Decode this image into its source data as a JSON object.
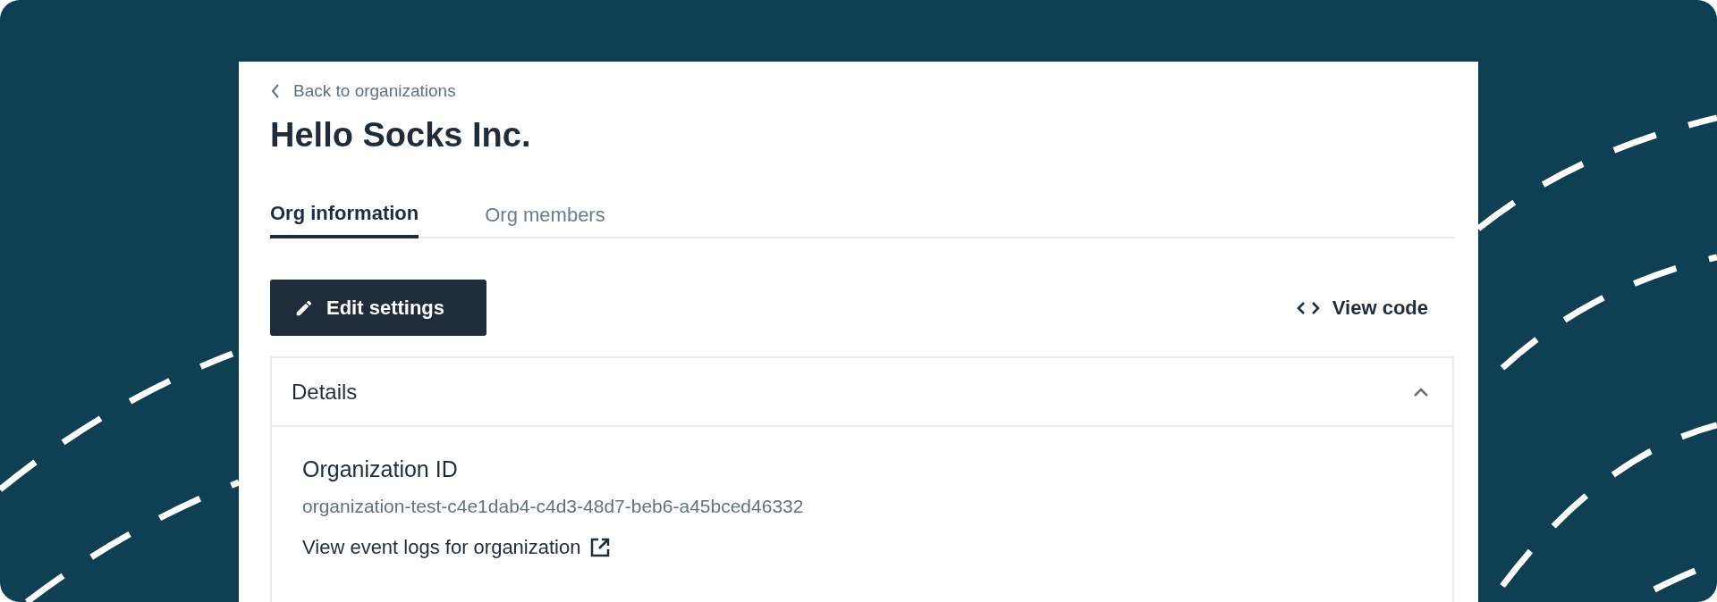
{
  "back_link": {
    "label": "Back to organizations"
  },
  "title": "Hello Socks Inc.",
  "tabs": [
    {
      "label": "Org information",
      "selected": true
    },
    {
      "label": "Org members",
      "selected": false
    }
  ],
  "actions": {
    "edit_button": "Edit settings",
    "view_code": "View code"
  },
  "details": {
    "heading": "Details",
    "expanded": true,
    "fields": [
      {
        "label": "Organization ID",
        "value": "organization-test-c4e1dab4-c4d3-48d7-beb6-a45bced46332"
      }
    ],
    "link": "View event logs for organization"
  }
}
